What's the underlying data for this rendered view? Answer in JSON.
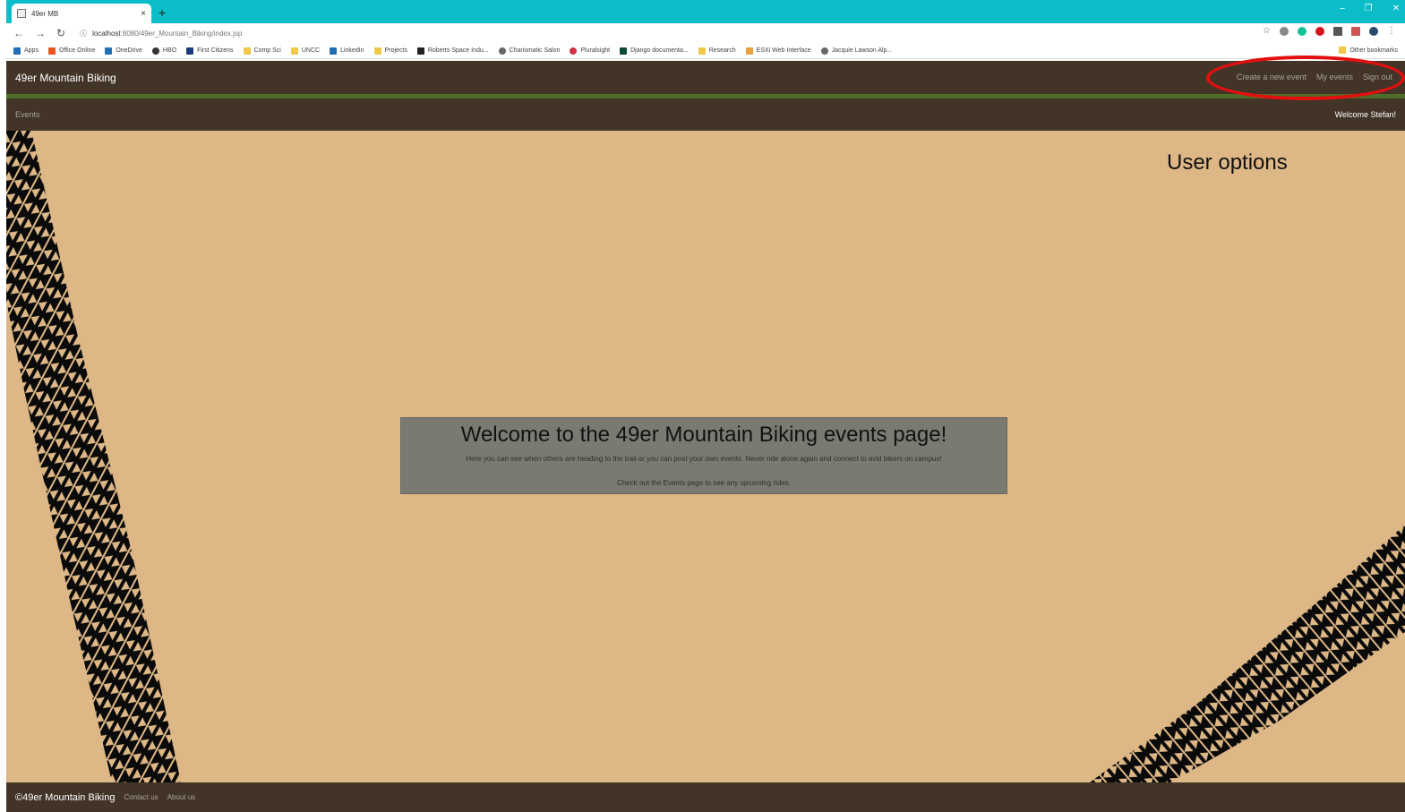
{
  "browser": {
    "tab_title": "49er MB",
    "tab_close": "×",
    "new_tab": "+",
    "url_host": "localhost",
    "url_rest": ":8080/49er_Mountain_Biking/index.jsp",
    "window_minimize": "–",
    "window_restore": "❐",
    "window_close": "✕",
    "bookmarks": [
      {
        "label": "Apps"
      },
      {
        "label": "Office Online"
      },
      {
        "label": "OneDrive"
      },
      {
        "label": "HBO"
      },
      {
        "label": "First Citizens"
      },
      {
        "label": "Comp Sci"
      },
      {
        "label": "UNCC"
      },
      {
        "label": "LinkedIn"
      },
      {
        "label": "Projects"
      },
      {
        "label": "Roberts Space Indu..."
      },
      {
        "label": "Charismatic Salon"
      },
      {
        "label": "Pluralsight"
      },
      {
        "label": "Django documenta..."
      },
      {
        "label": "Research"
      },
      {
        "label": "ESXi Web Interface"
      },
      {
        "label": "Jacquie Lawson Alp..."
      }
    ],
    "other_bookmarks": "Other bookmarks"
  },
  "site": {
    "brand": "49er Mountain Biking",
    "user_nav": {
      "create_event": "Create a new event",
      "my_events": "My events",
      "sign_out": "Sign out"
    },
    "sub_nav": {
      "events": "Events",
      "welcome_user": "Welcome Stefan!"
    },
    "annotation": "User options",
    "welcome": {
      "heading": "Welcome to the 49er Mountain Biking events page!",
      "line1": "Here you can see when others are heading to the trail or you can post your own events. Never ride alone again and connect to avid bikers on campus!",
      "line2": "Check out the Events page to see any upcoming rides."
    },
    "footer": {
      "copyright": "©49er Mountain Biking",
      "contact": "Contact us",
      "about": "About us"
    }
  },
  "colors": {
    "nav_bg": "#433428",
    "accent_green": "#4f6e28",
    "content_bg": "#ddb786",
    "annotation_red": "#e30f0f",
    "tab_strip": "#0bbcc9"
  }
}
